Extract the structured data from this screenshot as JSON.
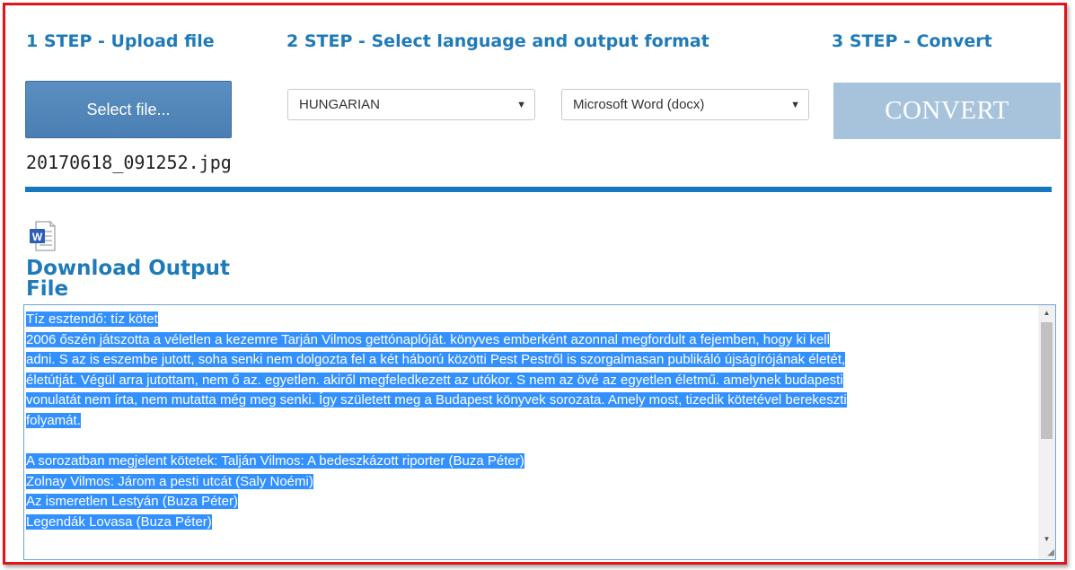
{
  "steps": {
    "step1": "1 STEP - Upload file",
    "step2": "2 STEP - Select language and output format",
    "step3": "3 STEP - Convert"
  },
  "upload": {
    "select_button_label": "Select file...",
    "filename": "20170618_091252.jpg"
  },
  "options": {
    "language": "HUNGARIAN",
    "output_format": "Microsoft Word (docx)"
  },
  "convert": {
    "button_label": "CONVERT"
  },
  "download": {
    "link_label": "Download Output File",
    "icon": "word-document-icon"
  },
  "output_text": {
    "lines": [
      "Tíz esztendő: tíz kötet ",
      "2006 őszén játszotta a véletlen a kezemre Tarján Vilmos gettónaplóját. könyves emberként azonnal megfordult a fejemben, hogy ki kell",
      "adni. S az is eszembe jutott, soha senki nem dolgozta fel a két háború közötti Pest Pestről is szorgalmasan publikáló újságírójának életét,",
      "életútját. Végül arra jutottam, nem ő az. egyetlen. akiről megfeledkezett az utókor. S nem az övé az egyetlen életmű. amelynek budapesti",
      "vonulatát nem írta, nem mutatta még meg senki. Így született meg a Budapest könyvek sorozata. Amely most, tizedik kötetével berekeszti",
      "folyamát. ",
      "",
      "A sorozatban megjelent kötetek: Talján Vilmos: A bedeszkázott riporter (Buza Péter) ",
      "Zolnay Vilmos: Járom a pesti utcát (Saly Noémi) ",
      "Az ismeretlen Lestyán (Buza Péter) ",
      "Legendák Lovasa (Buza Péter) "
    ]
  },
  "colors": {
    "accent": "#1f7ab8",
    "frame_border": "#e2141a",
    "select_button": "#4a7fb3",
    "convert_button_disabled": "#a7c3dc",
    "selection_highlight": "#3390ff"
  }
}
